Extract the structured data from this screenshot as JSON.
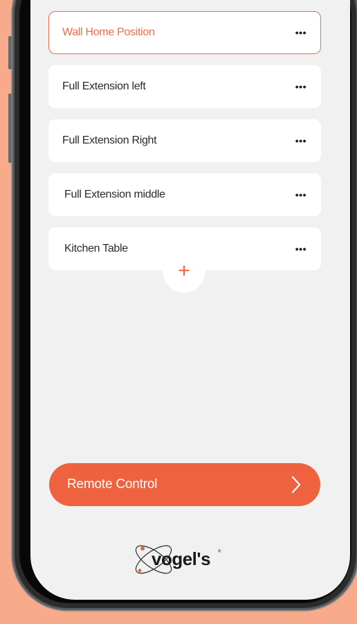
{
  "positions": [
    {
      "label": "Wall Home Position",
      "selected": true,
      "menu": "•••"
    },
    {
      "label": "Full Extension left",
      "selected": false,
      "menu": "•••"
    },
    {
      "label": "Full Extension Right",
      "selected": false,
      "menu": "•••"
    },
    {
      "label": "Full Extension middle",
      "selected": false,
      "menu": "•••"
    },
    {
      "label": "Kitchen Table",
      "selected": false,
      "menu": "•••"
    }
  ],
  "add_button": {
    "symbol": "+"
  },
  "remote_button": {
    "label": "Remote Control"
  },
  "brand": {
    "logo_text": "vogel's"
  },
  "colors": {
    "accent": "#ef6240",
    "background": "#f7ab8a",
    "screen": "#f1f1f1"
  }
}
